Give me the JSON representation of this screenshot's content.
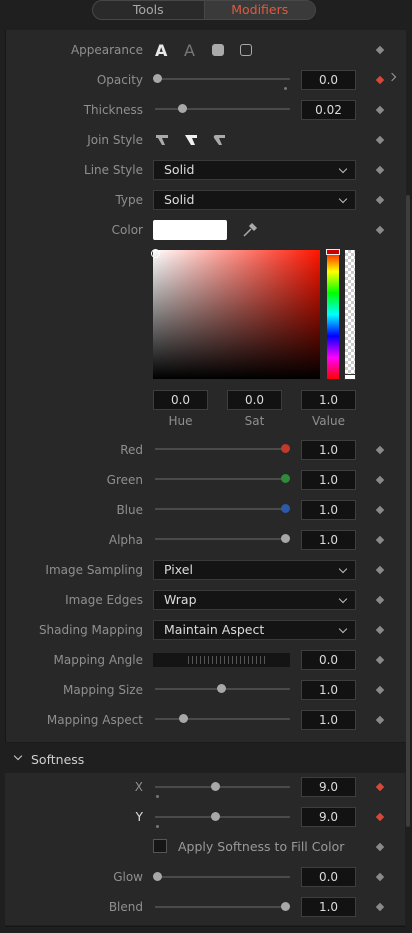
{
  "tabs": {
    "tools": "Tools",
    "modifiers": "Modifiers"
  },
  "appearance": {
    "label": "Appearance"
  },
  "opacity": {
    "label": "Opacity",
    "value": "0.0",
    "slider": 0.0
  },
  "thickness": {
    "label": "Thickness",
    "value": "0.02",
    "slider": 0.2
  },
  "join_style": {
    "label": "Join Style"
  },
  "line_style": {
    "label": "Line Style",
    "selected": "Solid"
  },
  "type": {
    "label": "Type",
    "selected": "Solid"
  },
  "color": {
    "label": "Color",
    "hue": "0.0",
    "sat": "0.0",
    "value": "1.0",
    "hue_label": "Hue",
    "sat_label": "Sat",
    "value_label": "Value"
  },
  "red": {
    "label": "Red",
    "value": "1.0",
    "dot": "#c0392b"
  },
  "green": {
    "label": "Green",
    "value": "1.0",
    "dot": "#2e8b3a"
  },
  "blue": {
    "label": "Blue",
    "value": "1.0",
    "dot": "#2b5aa8"
  },
  "alpha": {
    "label": "Alpha",
    "value": "1.0",
    "dot": "#aaaaaa"
  },
  "image_sampling": {
    "label": "Image Sampling",
    "selected": "Pixel"
  },
  "image_edges": {
    "label": "Image Edges",
    "selected": "Wrap"
  },
  "shading_mapping": {
    "label": "Shading Mapping",
    "selected": "Maintain Aspect"
  },
  "mapping_angle": {
    "label": "Mapping Angle",
    "value": "0.0"
  },
  "mapping_size": {
    "label": "Mapping Size",
    "value": "1.0",
    "slider": 0.5
  },
  "mapping_aspect": {
    "label": "Mapping Aspect",
    "value": "1.0",
    "slider": 0.2
  },
  "softness": {
    "header": "Softness",
    "x": {
      "label": "X",
      "value": "9.0",
      "slider": 0.45
    },
    "y": {
      "label": "Y",
      "value": "9.0",
      "slider": 0.45
    },
    "apply_label": "Apply Softness to Fill Color",
    "glow": {
      "label": "Glow",
      "value": "0.0",
      "slider": 0.0
    },
    "blend": {
      "label": "Blend",
      "value": "1.0",
      "slider": 1.0
    }
  }
}
